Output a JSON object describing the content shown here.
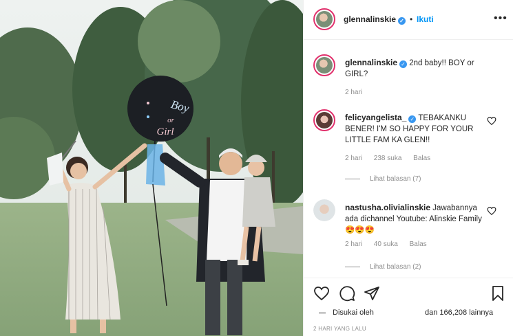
{
  "post_header": {
    "username": "glennalinskie",
    "verified_badge": "✓",
    "separator": "•",
    "follow_label": "Ikuti",
    "more_label": "•••"
  },
  "comments": [
    {
      "username": "glennalinskie",
      "verified_badge": "✓",
      "text": "2nd baby!! BOY or GIRL?",
      "time": "2 hari"
    },
    {
      "username": "felicyangelista_",
      "verified_badge": "✓",
      "text": "TEBAKANKU BENER! I'M SO HAPPY FOR YOUR LITTLE FAM KA GLEN!!",
      "time": "2 hari",
      "likes": "238 suka",
      "reply_label": "Balas",
      "view_replies": "Lihat balasan (7)"
    },
    {
      "username": "nastusha.olivialinskie",
      "text": "Jawabannya ada dichannel Youtube: Alinskie Family 😍😍😍",
      "time": "2 hari",
      "likes": "40 suka",
      "reply_label": "Balas",
      "view_replies": "Lihat balasan (2)"
    }
  ],
  "footer": {
    "liked_by_label": "Disukai oleh",
    "others_label": "dan 166,208 lainnya",
    "timestamp": "2 HARI YANG LALU"
  },
  "icons": {
    "like": "heart-icon",
    "comment": "comment-icon",
    "share": "paper-plane-icon",
    "save": "bookmark-icon",
    "more": "more-icon",
    "verified": "verified-badge-icon"
  },
  "colors": {
    "accent_link": "#0095f6",
    "verified": "#3897f0",
    "muted_text": "#8e8e8e",
    "primary_text": "#262626",
    "divider": "#efefef"
  }
}
